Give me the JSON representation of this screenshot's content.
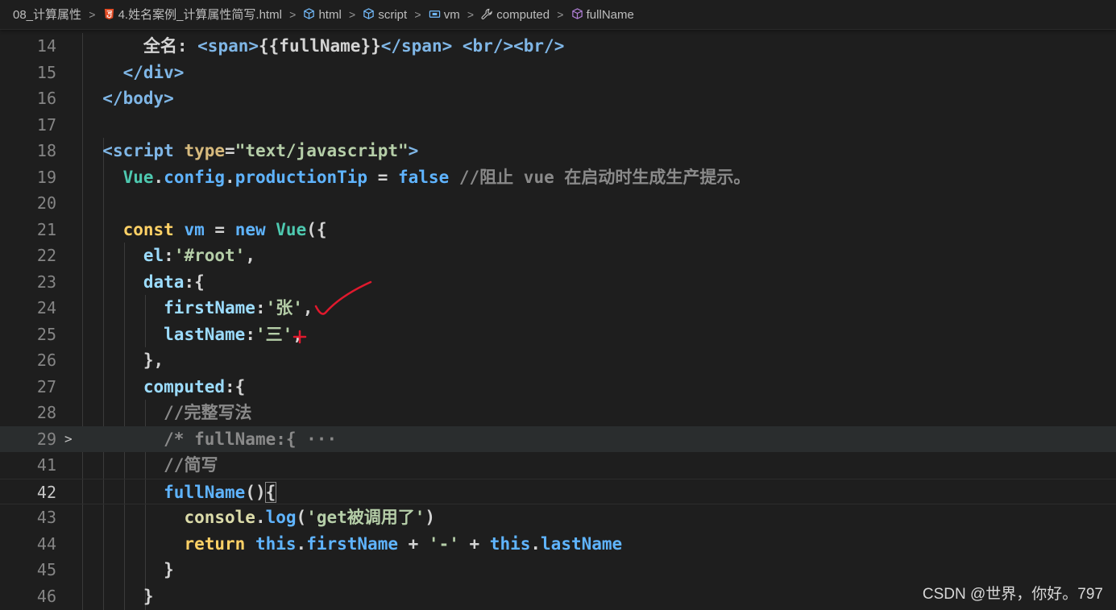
{
  "breadcrumb": {
    "folder": "08_计算属性",
    "file": "4.姓名案例_计算属性简写.html",
    "html": "html",
    "script": "script",
    "vm": "vm",
    "computed": "computed",
    "fullName": "fullName"
  },
  "lines": [
    {
      "num": "14",
      "tokens": [
        [
          "t-text",
          "      全名: "
        ],
        [
          "t-tag",
          "<span>"
        ],
        [
          "t-text",
          "{{fullName}}"
        ],
        [
          "t-tag",
          "</span>"
        ],
        [
          "t-text",
          " "
        ],
        [
          "t-tag",
          "<br/><br/>"
        ]
      ]
    },
    {
      "num": "15",
      "tokens": [
        [
          "t-text",
          "    "
        ],
        [
          "t-tag",
          "</div>"
        ]
      ]
    },
    {
      "num": "16",
      "tokens": [
        [
          "t-text",
          "  "
        ],
        [
          "t-tag",
          "</body>"
        ]
      ]
    },
    {
      "num": "17",
      "tokens": []
    },
    {
      "num": "18",
      "tokens": [
        [
          "t-text",
          "  "
        ],
        [
          "t-tag",
          "<script "
        ],
        [
          "t-attr",
          "type"
        ],
        [
          "t-text",
          "="
        ],
        [
          "t-strg",
          "\"text/javascript\""
        ],
        [
          "t-tag",
          ">"
        ]
      ]
    },
    {
      "num": "19",
      "tokens": [
        [
          "t-text",
          "    "
        ],
        [
          "t-type",
          "Vue"
        ],
        [
          "t-text",
          "."
        ],
        [
          "t-prop",
          "config"
        ],
        [
          "t-text",
          "."
        ],
        [
          "t-prop",
          "productionTip"
        ],
        [
          "t-text",
          " = "
        ],
        [
          "t-bool",
          "false"
        ],
        [
          "t-text",
          " "
        ],
        [
          "t-cmt",
          "//阻止 vue 在启动时生成生产提示。"
        ]
      ]
    },
    {
      "num": "20",
      "tokens": []
    },
    {
      "num": "21",
      "tokens": [
        [
          "t-text",
          "    "
        ],
        [
          "t-kw",
          "const"
        ],
        [
          "t-text",
          " "
        ],
        [
          "t-prop",
          "vm"
        ],
        [
          "t-text",
          " = "
        ],
        [
          "t-bool",
          "new"
        ],
        [
          "t-text",
          " "
        ],
        [
          "t-type",
          "Vue"
        ],
        [
          "t-text",
          "({"
        ]
      ]
    },
    {
      "num": "22",
      "tokens": [
        [
          "t-text",
          "      "
        ],
        [
          "t-key",
          "el"
        ],
        [
          "t-text",
          ":"
        ],
        [
          "t-strg",
          "'#root'"
        ],
        [
          "t-text",
          ","
        ]
      ]
    },
    {
      "num": "23",
      "tokens": [
        [
          "t-text",
          "      "
        ],
        [
          "t-key",
          "data"
        ],
        [
          "t-text",
          ":{"
        ]
      ]
    },
    {
      "num": "24",
      "tokens": [
        [
          "t-text",
          "        "
        ],
        [
          "t-key",
          "firstName"
        ],
        [
          "t-text",
          ":"
        ],
        [
          "t-strg",
          "'张'"
        ],
        [
          "t-text",
          ","
        ]
      ]
    },
    {
      "num": "25",
      "tokens": [
        [
          "t-text",
          "        "
        ],
        [
          "t-key",
          "lastName"
        ],
        [
          "t-text",
          ":"
        ],
        [
          "t-strg",
          "'三'"
        ],
        [
          "t-text",
          ","
        ]
      ]
    },
    {
      "num": "26",
      "tokens": [
        [
          "t-text",
          "      },"
        ]
      ]
    },
    {
      "num": "27",
      "tokens": [
        [
          "t-text",
          "      "
        ],
        [
          "t-key",
          "computed"
        ],
        [
          "t-text",
          ":{"
        ]
      ]
    },
    {
      "num": "28",
      "tokens": [
        [
          "t-text",
          "        "
        ],
        [
          "t-cmt",
          "//完整写法"
        ]
      ]
    },
    {
      "num": "29",
      "tokens": [
        [
          "t-text",
          "        "
        ],
        [
          "t-cmt",
          "/* fullName:{ ···"
        ]
      ],
      "folded": true
    },
    {
      "num": "41",
      "tokens": [
        [
          "t-text",
          "        "
        ],
        [
          "t-cmt",
          "//简写"
        ]
      ]
    },
    {
      "num": "42",
      "tokens": [
        [
          "t-text",
          "        "
        ],
        [
          "t-prop",
          "fullName"
        ],
        [
          "t-text",
          "()"
        ],
        [
          "t-text",
          "{"
        ]
      ],
      "active": true
    },
    {
      "num": "43",
      "tokens": [
        [
          "t-text",
          "          "
        ],
        [
          "t-fn",
          "console"
        ],
        [
          "t-text",
          "."
        ],
        [
          "t-prop",
          "log"
        ],
        [
          "t-text",
          "("
        ],
        [
          "t-strg",
          "'get被调用了'"
        ],
        [
          "t-text",
          ")"
        ]
      ]
    },
    {
      "num": "44",
      "tokens": [
        [
          "t-text",
          "          "
        ],
        [
          "t-kw",
          "return"
        ],
        [
          "t-text",
          " "
        ],
        [
          "t-bool",
          "this"
        ],
        [
          "t-text",
          "."
        ],
        [
          "t-prop",
          "firstName"
        ],
        [
          "t-text",
          " + "
        ],
        [
          "t-strg",
          "'-'"
        ],
        [
          "t-text",
          " + "
        ],
        [
          "t-bool",
          "this"
        ],
        [
          "t-text",
          "."
        ],
        [
          "t-prop",
          "lastName"
        ]
      ]
    },
    {
      "num": "45",
      "tokens": [
        [
          "t-text",
          "        }"
        ]
      ]
    },
    {
      "num": "46",
      "tokens": [
        [
          "t-text",
          "      }"
        ]
      ]
    }
  ],
  "watermark": "CSDN @世界，你好。797",
  "colors": {
    "background": "#1e1e1e",
    "annotation": "#e0192d"
  }
}
